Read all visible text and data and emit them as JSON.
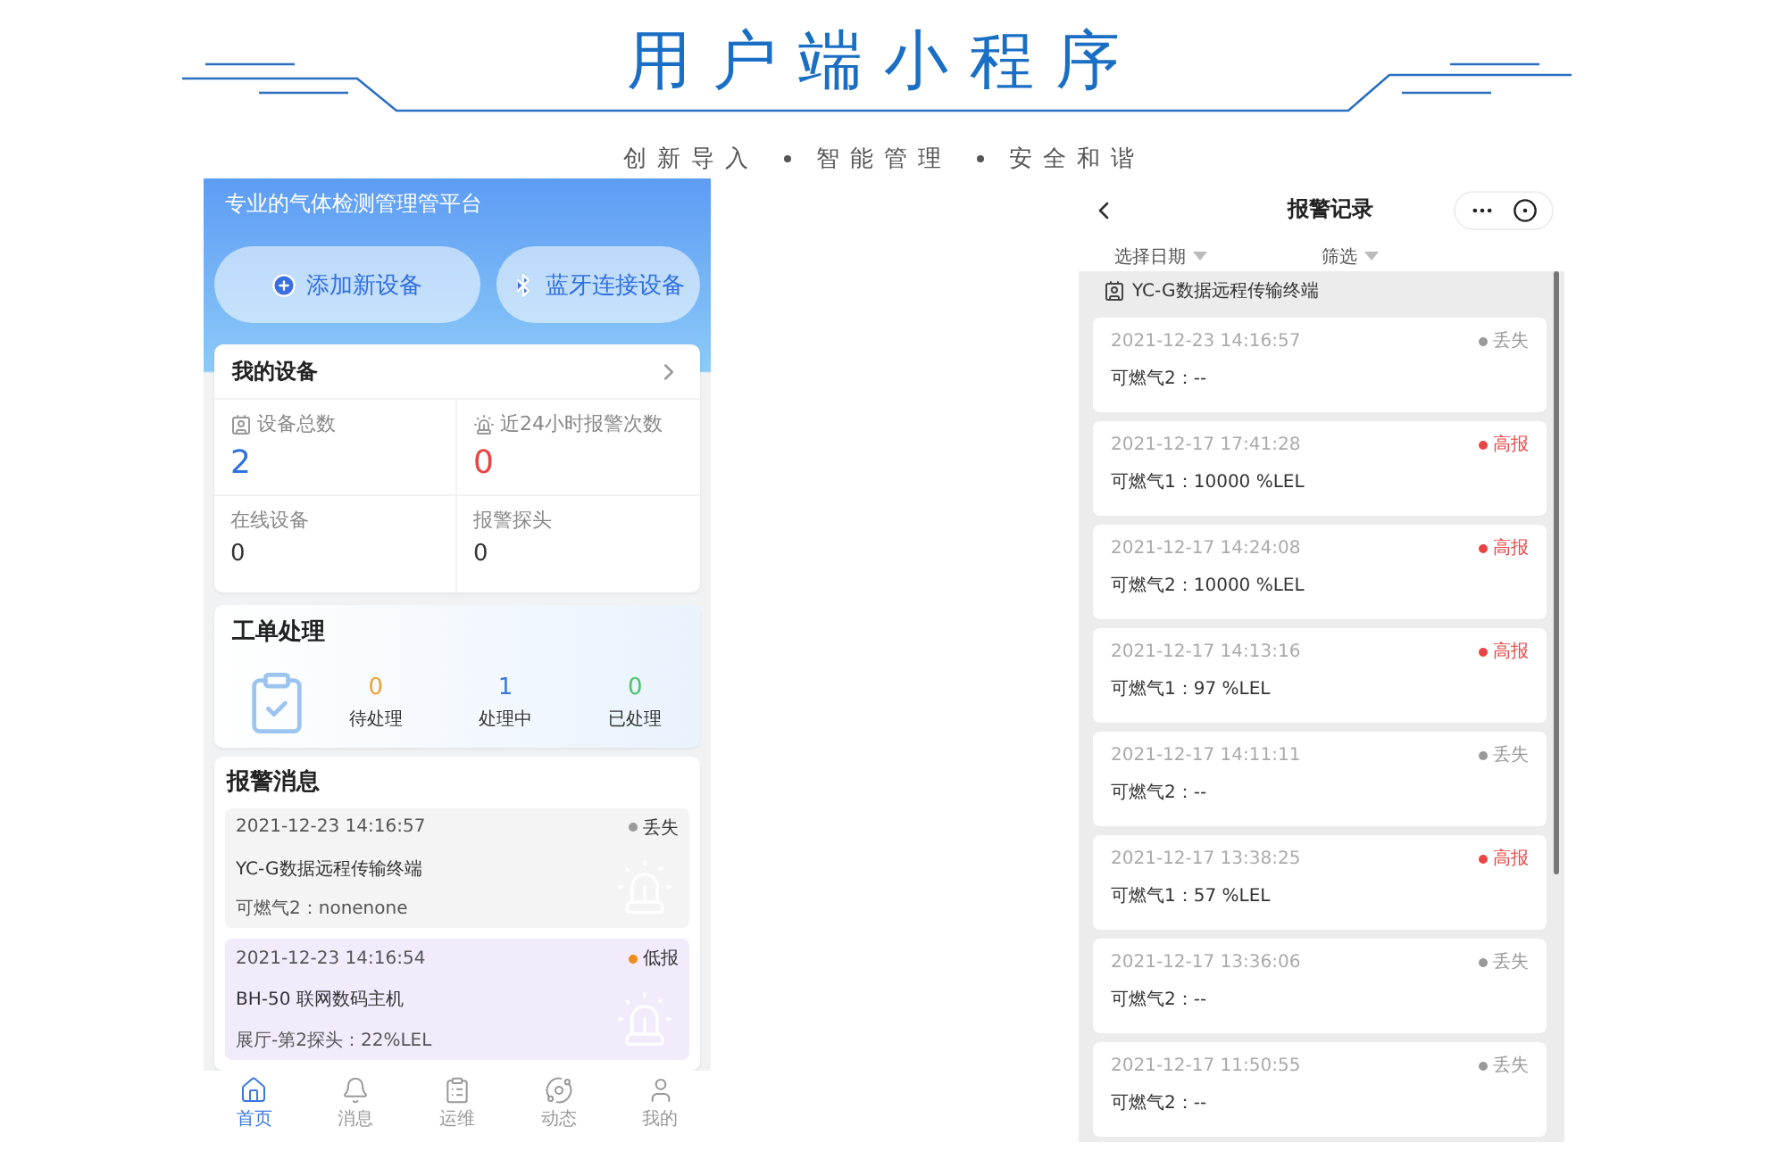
{
  "banner": {
    "title": "用户端小程序",
    "slogans": [
      "创新导入",
      "智能管理",
      "安全和谐"
    ]
  },
  "home": {
    "tagline": "专业的气体检测管理管平台",
    "actions": [
      "添加新设备",
      "蓝牙连接设备"
    ],
    "devices": {
      "title": "我的设备",
      "stats": [
        {
          "label": "设备总数",
          "value": "2",
          "color": "#2f6fe0"
        },
        {
          "label": "近24小时报警次数",
          "value": "0",
          "color": "#e84545"
        },
        {
          "label": "在线设备",
          "value": "0",
          "color": "#333333"
        },
        {
          "label": "报警探头",
          "value": "0",
          "color": "#333333"
        }
      ]
    },
    "orders": {
      "title": "工单处理",
      "stats": [
        {
          "value": "0",
          "label": "待处理",
          "color": "#f0a030"
        },
        {
          "value": "1",
          "label": "处理中",
          "color": "#3a78e0"
        },
        {
          "value": "0",
          "label": "已处理",
          "color": "#4cc36a"
        }
      ]
    },
    "alarms": {
      "title": "报警消息",
      "items": [
        {
          "kind": "lost",
          "time": "2021-12-23 14:16:57",
          "status": "丢失",
          "color": "#999999",
          "device": "YC-G数据远程传输终端",
          "reading": "可燃气2：nonenone"
        },
        {
          "kind": "low",
          "time": "2021-12-23 14:16:54",
          "status": "低报",
          "color": "#f08c1e",
          "device": "BH-50 联网数码主机",
          "reading": "展厅-第2探头：22%LEL"
        }
      ]
    },
    "tabs": [
      {
        "label": "首页",
        "selected": true
      },
      {
        "label": "消息",
        "selected": false
      },
      {
        "label": "运维",
        "selected": false
      },
      {
        "label": "动态",
        "selected": false
      },
      {
        "label": "我的",
        "selected": false
      }
    ]
  },
  "records": {
    "title": "报警记录",
    "filters": [
      "选择日期",
      "筛选"
    ],
    "group": "YC-G数据远程传输终端",
    "items": [
      {
        "time": "2021-12-23 14:16:57",
        "status": "丢失",
        "color": "#999999",
        "reading": "可燃气2：--"
      },
      {
        "time": "2021-12-17 17:41:28",
        "status": "高报",
        "color": "#e84545",
        "reading": "可燃气1：10000 %LEL"
      },
      {
        "time": "2021-12-17 14:24:08",
        "status": "高报",
        "color": "#e84545",
        "reading": "可燃气2：10000 %LEL"
      },
      {
        "time": "2021-12-17 14:13:16",
        "status": "高报",
        "color": "#e84545",
        "reading": "可燃气1：97 %LEL"
      },
      {
        "time": "2021-12-17 14:11:11",
        "status": "丢失",
        "color": "#999999",
        "reading": "可燃气2：--"
      },
      {
        "time": "2021-12-17 13:38:25",
        "status": "高报",
        "color": "#e84545",
        "reading": "可燃气1：57 %LEL"
      },
      {
        "time": "2021-12-17 13:36:06",
        "status": "丢失",
        "color": "#999999",
        "reading": "可燃气2：--"
      },
      {
        "time": "2021-12-17 11:50:55",
        "status": "丢失",
        "color": "#999999",
        "reading": "可燃气2：--"
      }
    ]
  }
}
